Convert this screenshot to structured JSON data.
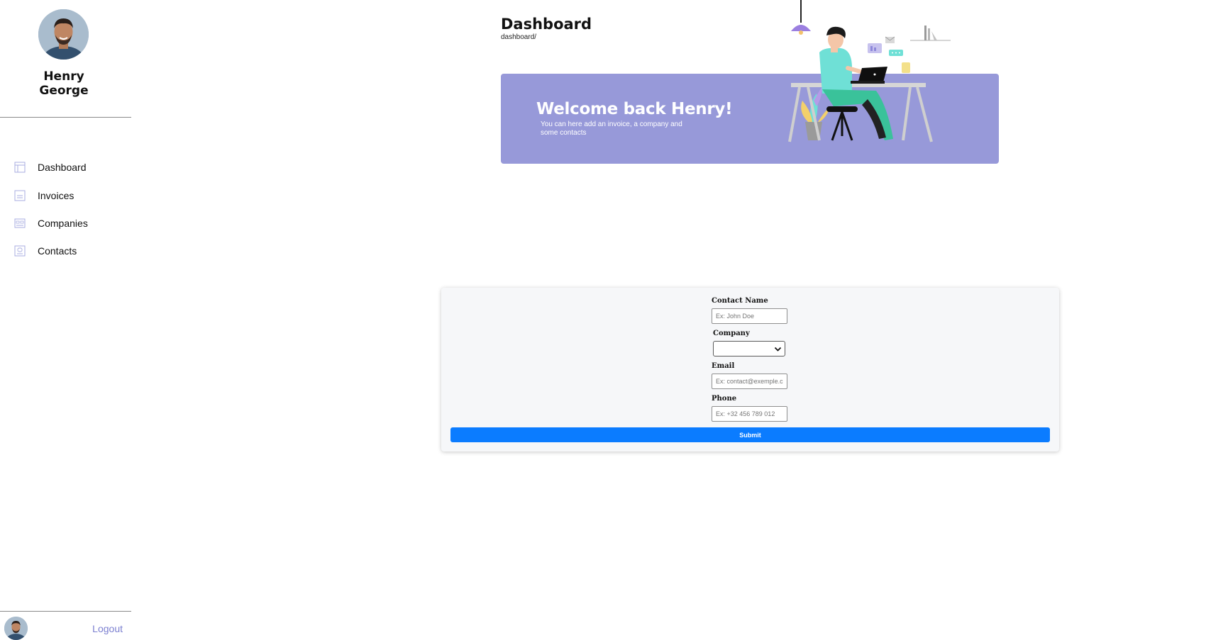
{
  "sidebar": {
    "profile": {
      "first_name": "Henry",
      "last_name": "George",
      "avatar_icon": "user-avatar"
    },
    "nav_items": [
      {
        "label": "Dashboard",
        "icon": "dashboard-icon"
      },
      {
        "label": "Invoices",
        "icon": "invoice-icon"
      },
      {
        "label": "Companies",
        "icon": "company-icon"
      },
      {
        "label": "Contacts",
        "icon": "contact-icon"
      }
    ],
    "logout_label": "Logout"
  },
  "header": {
    "title": "Dashboard",
    "breadcrumb": "dashboard/"
  },
  "banner": {
    "title": "Welcome back Henry!",
    "subtitle": "You can here add an invoice, a company and some contacts"
  },
  "form": {
    "contact_name": {
      "label": "Contact Name",
      "placeholder": "Ex: John Doe",
      "value": ""
    },
    "company": {
      "label": "Company",
      "selected": ""
    },
    "email": {
      "label": "Email",
      "placeholder": "Ex: contact@exemple.com",
      "value": ""
    },
    "phone": {
      "label": "Phone",
      "placeholder": "Ex: +32 456 789 012",
      "value": ""
    },
    "submit_label": "Submit"
  },
  "colors": {
    "accent": "#7b7fd0",
    "banner_bg": "#9799d9",
    "submit_bg": "#0b7cff",
    "card_bg": "#f6f7f9"
  }
}
